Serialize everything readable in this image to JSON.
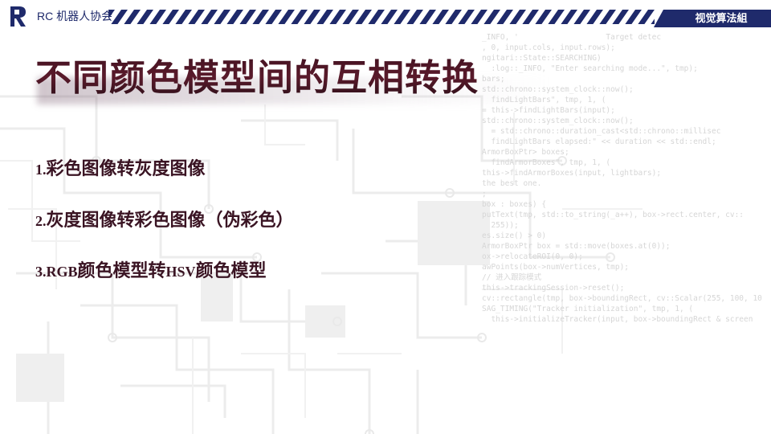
{
  "header": {
    "org_name": "RC 机器人协会",
    "group_label": "视觉算法組",
    "accent_color": "#1f2a6b"
  },
  "slide": {
    "title": "不同颜色模型间的互相转换",
    "items": [
      {
        "number": "1.",
        "text": "彩色图像转灰度图像"
      },
      {
        "number": "2.",
        "text": "灰度图像转彩色图像（伪彩色）"
      },
      {
        "number": "3.",
        "prefix": "RGB",
        "middle": "颜色模型转",
        "latin": "HSV",
        "suffix": "颜色模型"
      }
    ]
  },
  "background_code": [
    "_INFO, '                   Target detec",
    "",
    ", 0, input.cols, input.rows);",
    "",
    "",
    "ngitari::State::SEARCHING)",
    "",
    "  :log::_INFO, \"Enter searching mode...\", tmp);",
    "bars;",
    "std::chrono::system_clock::now();",
    "  findLightBars\", tmp, 1, (",
    "= this->findLightBars(input);",
    "",
    "std::chrono::system_clock::now();",
    "  = std::chrono::duration_cast<std::chrono::millisec",
    "  findLightBars elapsed:\" << duration << std::endl;",
    "ArmorBoxPtr> boxes;",
    "  findArmorBoxes\", tmp, 1, (",
    "this->findArmorBoxes(input, lightbars);",
    "",
    "",
    "the best one.",
    ";",
    "box : boxes) {",
    "putText(tmp, std::to_string(_a++), box->rect.center, cv::",
    "  255));",
    "",
    "es.size() > 0)",
    "",
    "ArmorBoxPtr box = std::move(boxes.at(0));",
    "ox->relocateROI(0, 0);",
    "awPoints(box->numVertices, tmp);",
    "",
    "// 进入跟踪模式",
    "this->trackingSession->reset();",
    "cv::rectangle(tmp, box->boundingRect, cv::Scalar(255, 100, 10",
    "SAG_TIMING(\"Tracker initialization\", tmp, 1, (",
    "  this->initializeTracker(input, box->boundingRect & screen"
  ]
}
